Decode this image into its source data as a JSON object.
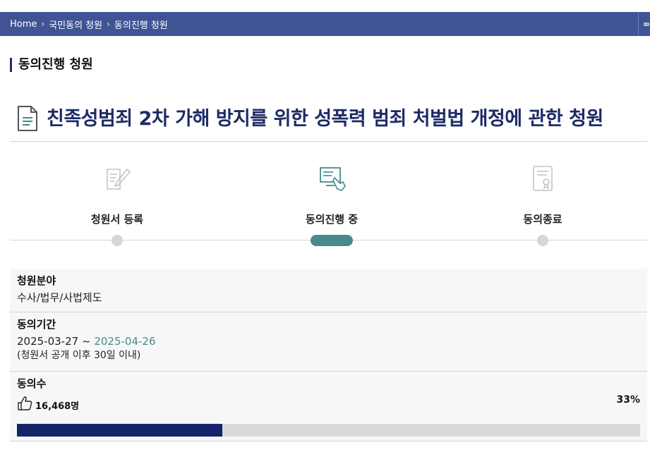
{
  "breadcrumb": {
    "items": [
      "Home",
      "국민동의 청원",
      "동의진행 청원"
    ],
    "share_symbol": "∞"
  },
  "section": {
    "title": "동의진행 청원"
  },
  "petition": {
    "icon": "document-icon",
    "title": "친족성범죄 2차 가해 방지를 위한 성폭력 범죄 처벌법 개정에 관한 청원"
  },
  "steps": [
    {
      "label": "청원서 등록",
      "icon": "pen-document-icon",
      "state": "inactive"
    },
    {
      "label": "동의진행 중",
      "icon": "monitor-hand-icon",
      "state": "active"
    },
    {
      "label": "동의종료",
      "icon": "certificate-icon",
      "state": "inactive"
    }
  ],
  "info": {
    "category": {
      "label": "청원분야",
      "value": "수사/법무/사법제도"
    },
    "period": {
      "label": "동의기간",
      "start": "2025-03-27",
      "separator": "~",
      "end": "2025-04-26",
      "note": "(청원서 공개 이후 30일 이내)"
    },
    "agree": {
      "label": "동의수",
      "count": "16,468명",
      "percent_text": "33%",
      "progress": 0.33,
      "icon": "thumbs-up-icon"
    }
  },
  "colors": {
    "header_bg": "#3f5395",
    "title_navy": "#1d2b66",
    "accent_teal": "#4a8a8b",
    "progress_fill": "#14246b",
    "progress_track": "#dadada"
  }
}
